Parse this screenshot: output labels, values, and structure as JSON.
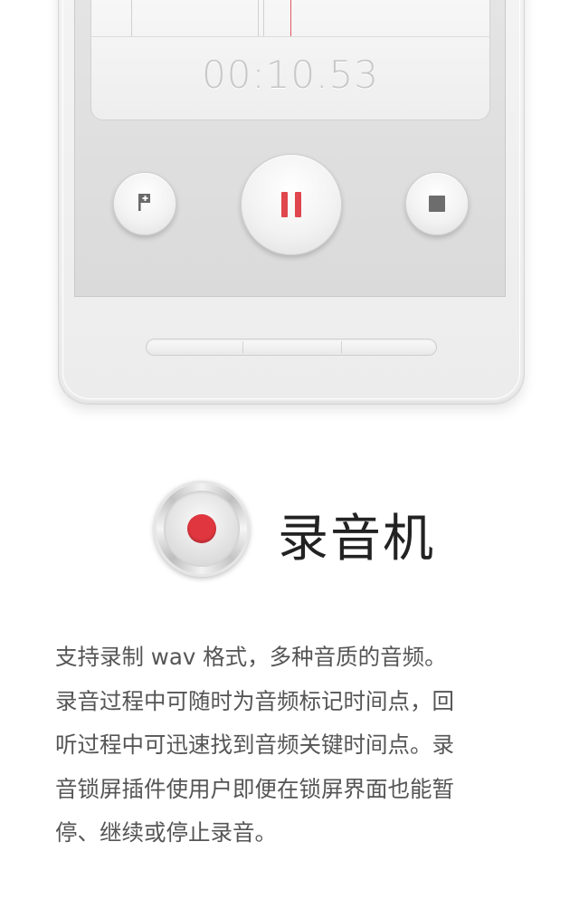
{
  "recorder": {
    "timer": "00:10.53",
    "buttons": {
      "mark": "flag-plus-icon",
      "pause": "pause-icon",
      "stop": "stop-icon"
    },
    "accent_color": "#e0464d"
  },
  "feature": {
    "icon": "record-icon",
    "title": "录音机",
    "description_lines": [
      "支持录制 wav 格式，多种音质的音频。",
      "录音过程中可随时为音频标记时间点，回",
      "听过程中可迅速找到音频关键时间点。录",
      "音锁屏插件使用户即便在锁屏界面也能暂",
      "停、继续或停止录音。"
    ]
  }
}
